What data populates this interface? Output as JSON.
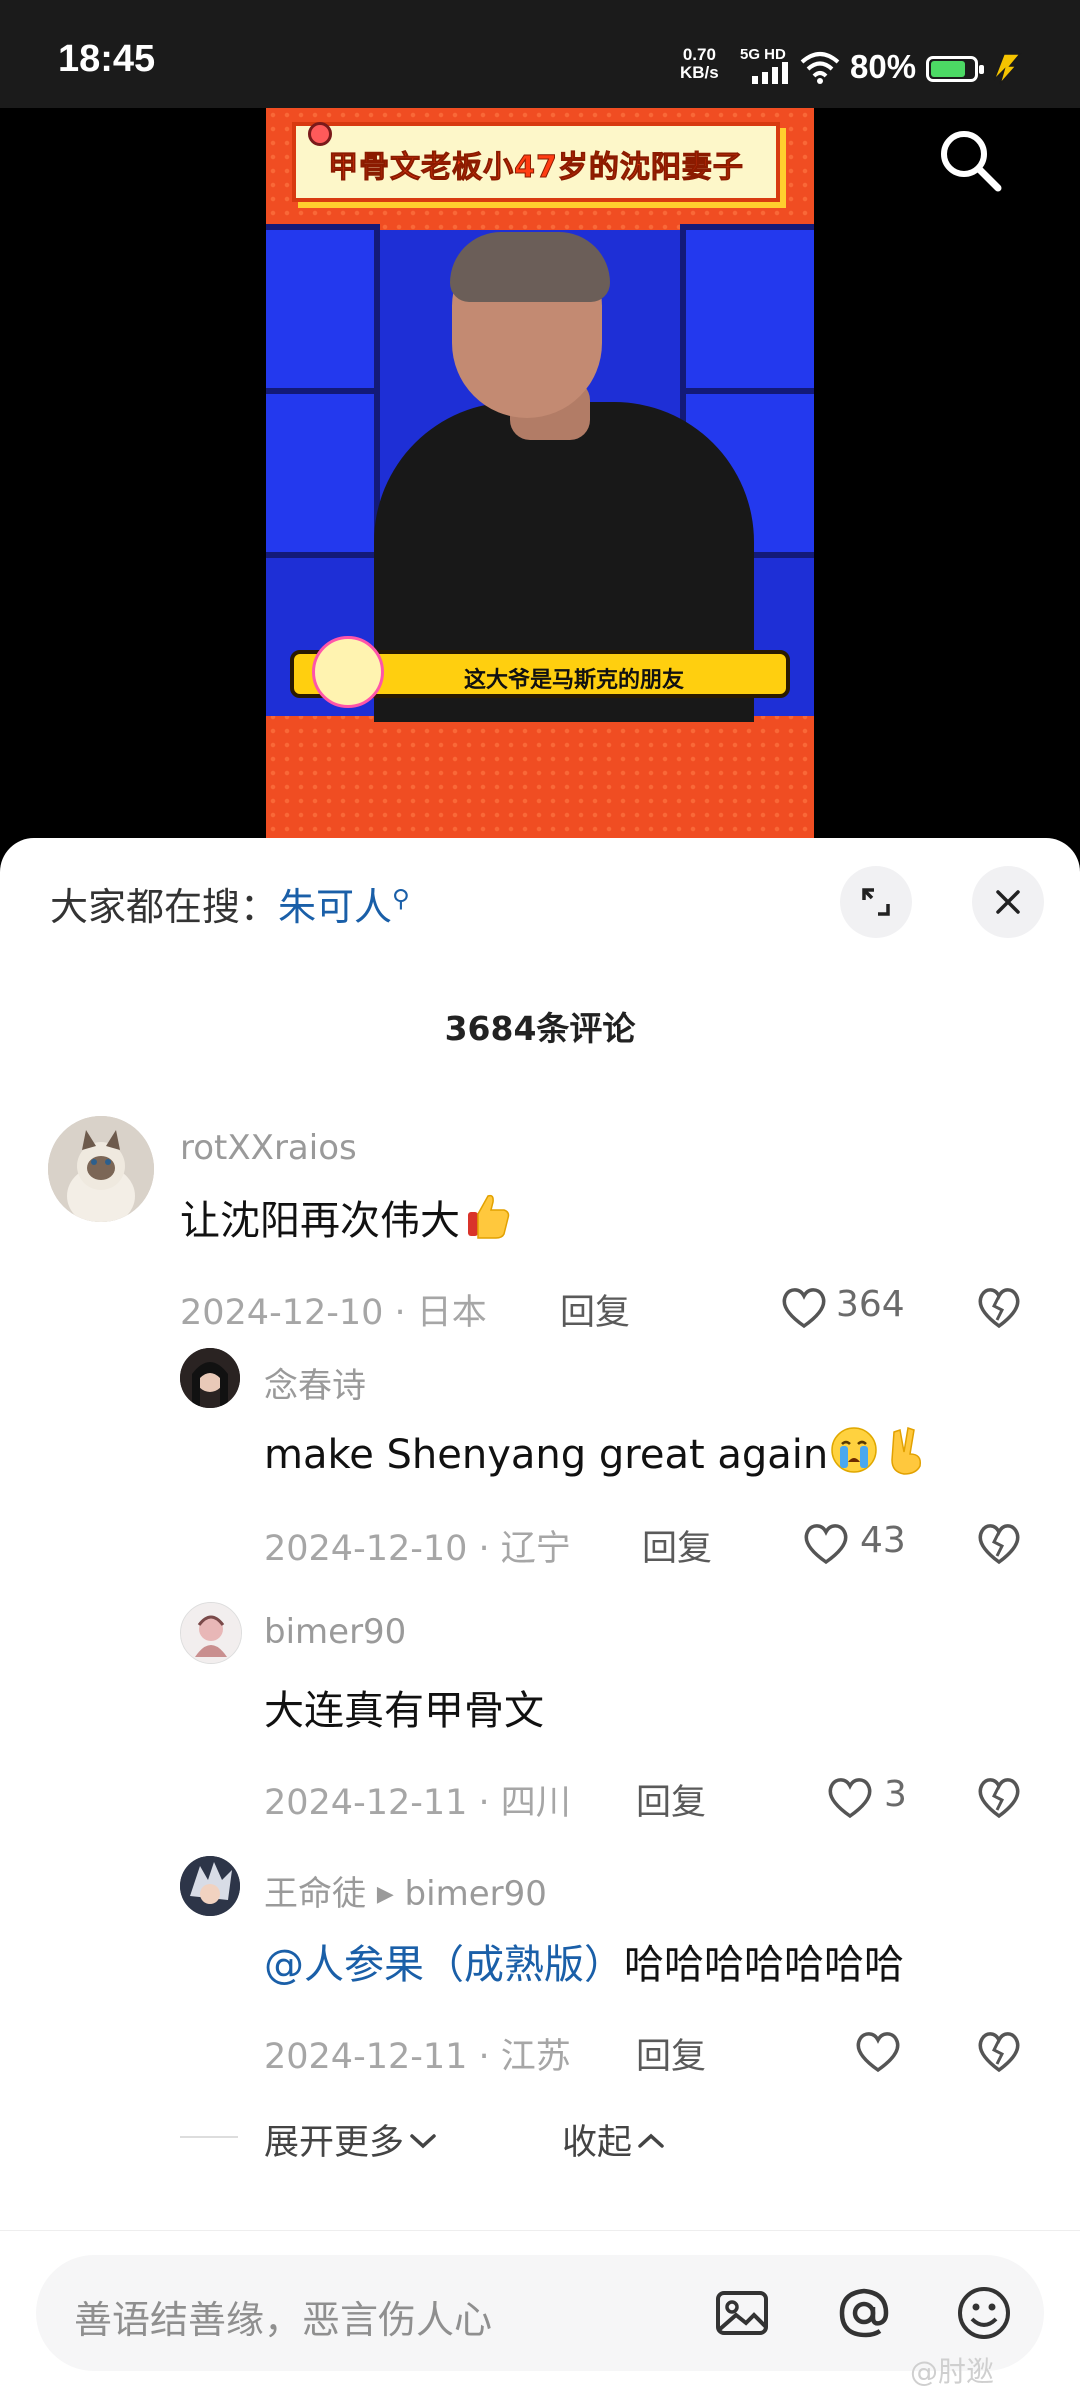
{
  "status_bar": {
    "time": "18:45",
    "network_speed": "0.70",
    "network_unit": "KB/s",
    "signal_type": "5G HD",
    "battery_percent_text": "80%",
    "battery_level": 0.8,
    "battery_color": "#4cd964"
  },
  "video": {
    "banner_title": "甲骨文老板小47岁的沈阳妻子",
    "subtitle": "这大爷是马斯克的朋友",
    "background_color": "#f04d22"
  },
  "sheet": {
    "trending_label": "大家都在搜：",
    "trending_keyword": "朱可人",
    "comment_count": "3684条评论",
    "comments": [
      {
        "username": "rotXXraios",
        "text": "让沈阳再次伟大",
        "date": "2024-12-10",
        "location": "日本",
        "reply_label": "回复",
        "likes": "364"
      },
      {
        "username": "念春诗",
        "text": "make Shenyang great again",
        "date": "2024-12-10",
        "location": "辽宁",
        "reply_label": "回复",
        "likes": "43"
      },
      {
        "username": "bimer90",
        "text": "大连真有甲骨文",
        "date": "2024-12-11",
        "location": "四川",
        "reply_label": "回复",
        "likes": "3"
      },
      {
        "username": "王命徒",
        "reply_to": "bimer90",
        "mention": "@人参果（成熟版）",
        "text": "哈哈哈哈哈哈哈",
        "date": "2024-12-11",
        "location": "江苏",
        "reply_label": "回复",
        "likes": ""
      }
    ],
    "expand_more": "展开更多",
    "collapse": "收起",
    "input_placeholder": "善语结善缘，恶言伤人心",
    "watermark": "@肘逖"
  },
  "icons": {
    "search": "search-icon",
    "expand": "expand-icon",
    "close": "close-icon",
    "heart": "heart-icon",
    "dislike": "broken-heart-icon",
    "image": "image-icon",
    "at": "at-icon",
    "emoji": "emoji-icon"
  },
  "colors": {
    "link": "#1a5fa8",
    "accent_red": "#f04d22"
  }
}
